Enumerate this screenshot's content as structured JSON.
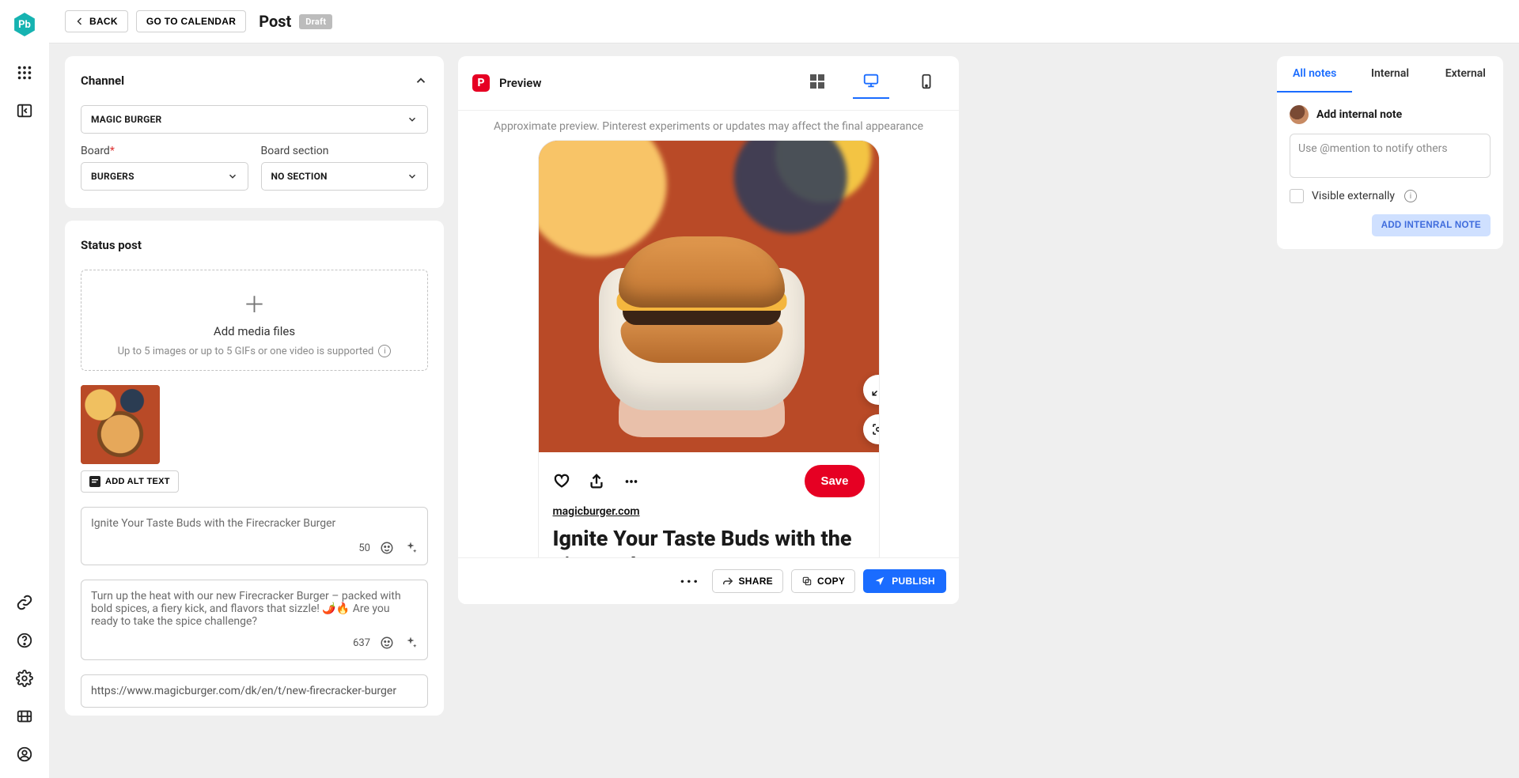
{
  "logo_text": "Pb",
  "top": {
    "back": "BACK",
    "go_to_calendar": "GO TO CALENDAR",
    "title": "Post",
    "status": "Draft"
  },
  "channel": {
    "heading": "Channel",
    "account": "MAGIC BURGER",
    "board_label": "Board",
    "board_value": "BURGERS",
    "section_label": "Board section",
    "section_value": "NO SECTION"
  },
  "status_post": {
    "heading": "Status post",
    "add_media": "Add media files",
    "hint": "Up to 5 images or up to 5 GIFs or one video is supported",
    "alt_button": "ADD ALT TEXT",
    "title_value": "Ignite Your Taste Buds with the Firecracker Burger",
    "title_count": "50",
    "desc_value": "Turn up the heat with our new Firecracker Burger – packed with bold spices, a fiery kick, and flavors that sizzle! 🌶️🔥 Are you ready to take the spice challenge?",
    "desc_count": "637",
    "link_value": "https://www.magicburger.com/dk/en/t/new-firecracker-burger"
  },
  "preview": {
    "label": "Preview",
    "disclaimer": "Approximate preview. Pinterest experiments or updates may affect the final appearance",
    "domain": "magicburger.com",
    "pin_title": "Ignite Your Taste Buds with the Firecracker Burger",
    "save": "Save",
    "share": "SHARE",
    "copy": "COPY",
    "publish": "PUBLISH"
  },
  "notes": {
    "tab_all": "All notes",
    "tab_internal": "Internal",
    "tab_external": "External",
    "heading": "Add internal note",
    "placeholder": "Use @mention to notify others",
    "visible_label": "Visible externally",
    "add_button": "ADD INTENRAL NOTE"
  }
}
